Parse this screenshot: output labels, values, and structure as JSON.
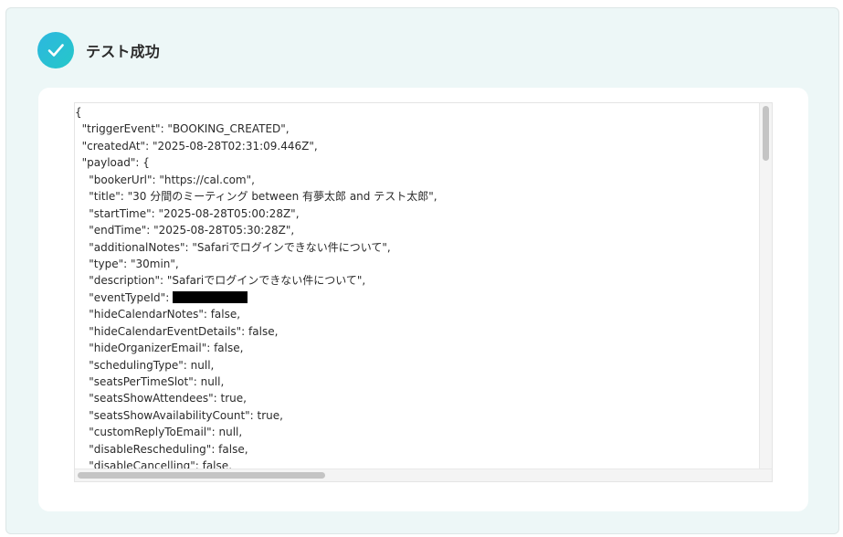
{
  "header": {
    "title": "テスト成功",
    "status_icon": "check-circle-icon",
    "status_color": "#2bbfd6"
  },
  "code": {
    "lines": [
      "{",
      "  \"triggerEvent\": \"BOOKING_CREATED\",",
      "  \"createdAt\": \"2025-08-28T02:31:09.446Z\",",
      "  \"payload\": {",
      "    \"bookerUrl\": \"https://cal.com\",",
      "    \"title\": \"30 分間のミーティング between 有夢太郎 and テスト太郎\",",
      "    \"startTime\": \"2025-08-28T05:00:28Z\",",
      "    \"endTime\": \"2025-08-28T05:30:28Z\",",
      "    \"additionalNotes\": \"Safariでログインできない件について\",",
      "    \"type\": \"30min\",",
      "    \"description\": \"Safariでログインできない件について\",",
      "    \"eventTypeId\": ",
      "    \"hideCalendarNotes\": false,",
      "    \"hideCalendarEventDetails\": false,",
      "    \"hideOrganizerEmail\": false,",
      "    \"schedulingType\": null,",
      "    \"seatsPerTimeSlot\": null,",
      "    \"seatsShowAttendees\": true,",
      "    \"seatsShowAvailabilityCount\": true,",
      "    \"customReplyToEmail\": null,",
      "    \"disableRescheduling\": false,",
      "    \"disableCancelling\": false,"
    ]
  }
}
